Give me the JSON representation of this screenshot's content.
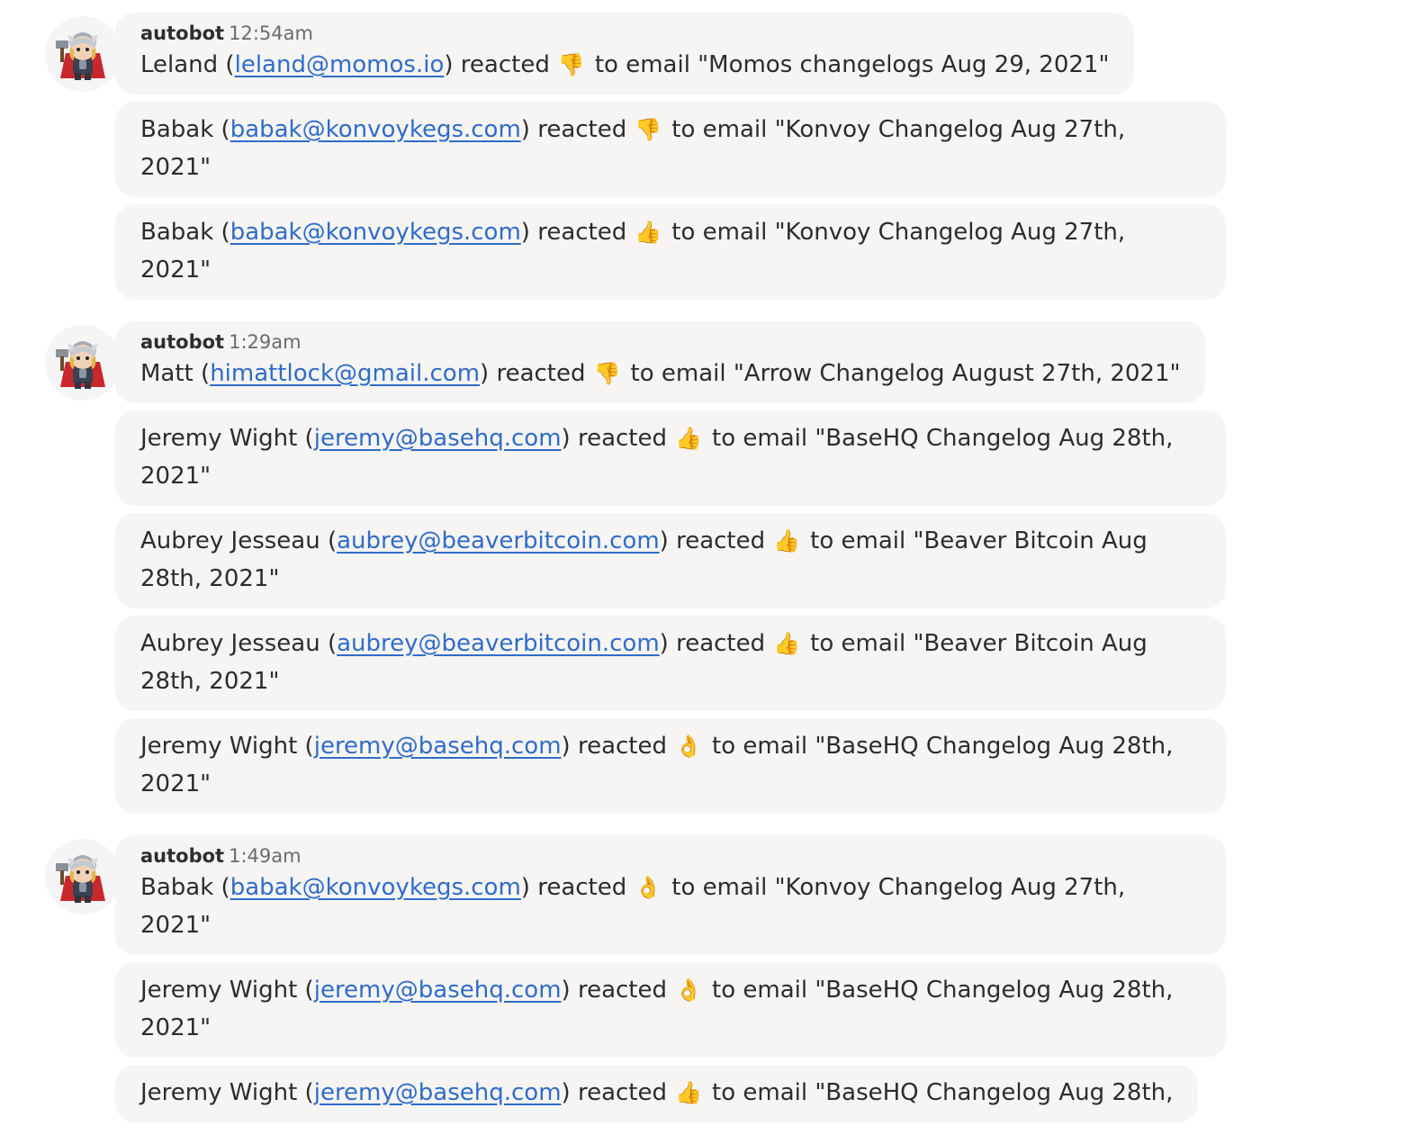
{
  "groups": [
    {
      "sender": "autobot",
      "time": "12:54am",
      "messages": [
        {
          "name": "Leland",
          "email": "leland@momos.io",
          "verb": "reacted",
          "reaction": "thumbs-down",
          "glyph": "👎",
          "subject": "to email \"Momos changelogs Aug 29, 2021\""
        },
        {
          "name": "Babak",
          "email": "babak@konvoykegs.com",
          "verb": "reacted",
          "reaction": "thumbs-down",
          "glyph": "👎",
          "subject": "to email \"Konvoy Changelog Aug 27th, 2021\""
        },
        {
          "name": "Babak",
          "email": "babak@konvoykegs.com",
          "verb": "reacted",
          "reaction": "thumbs-up",
          "glyph": "👍",
          "subject": "to email \"Konvoy Changelog Aug 27th, 2021\""
        }
      ]
    },
    {
      "sender": "autobot",
      "time": "1:29am",
      "messages": [
        {
          "name": "Matt",
          "email": "himattlock@gmail.com",
          "verb": "reacted",
          "reaction": "thumbs-down",
          "glyph": "👎",
          "subject": "to email \"Arrow Changelog August 27th, 2021\""
        },
        {
          "name": "Jeremy Wight",
          "email": "jeremy@basehq.com",
          "verb": "reacted",
          "reaction": "thumbs-up",
          "glyph": "👍",
          "subject": "to email \"BaseHQ Changelog Aug 28th, 2021\""
        },
        {
          "name": "Aubrey Jesseau",
          "email": "aubrey@beaverbitcoin.com",
          "verb": "reacted",
          "reaction": "thumbs-up",
          "glyph": "👍",
          "subject": "to email \"Beaver Bitcoin Aug 28th, 2021\""
        },
        {
          "name": "Aubrey Jesseau",
          "email": "aubrey@beaverbitcoin.com",
          "verb": "reacted",
          "reaction": "thumbs-up",
          "glyph": "👍",
          "subject": "to email \"Beaver Bitcoin Aug 28th, 2021\""
        },
        {
          "name": "Jeremy Wight",
          "email": "jeremy@basehq.com",
          "verb": "reacted",
          "reaction": "ok-hand",
          "glyph": "👌",
          "subject": "to email \"BaseHQ Changelog Aug 28th, 2021\""
        }
      ]
    },
    {
      "sender": "autobot",
      "time": "1:49am",
      "messages": [
        {
          "name": "Babak",
          "email": "babak@konvoykegs.com",
          "verb": "reacted",
          "reaction": "ok-hand",
          "glyph": "👌",
          "subject": "to email \"Konvoy Changelog Aug 27th, 2021\""
        },
        {
          "name": "Jeremy Wight",
          "email": "jeremy@basehq.com",
          "verb": "reacted",
          "reaction": "ok-hand",
          "glyph": "👌",
          "subject": "to email \"BaseHQ Changelog Aug 28th, 2021\""
        },
        {
          "name": "Jeremy Wight",
          "email": "jeremy@basehq.com",
          "verb": "reacted",
          "reaction": "thumbs-up",
          "glyph": "👍",
          "subject": "to email \"BaseHQ Changelog Aug 28th,"
        }
      ]
    }
  ],
  "colors": {
    "link": "#2f6cc9",
    "bubble": "#f6f5f4",
    "text": "#2c2c2c",
    "meta": "#6b6b6b"
  }
}
